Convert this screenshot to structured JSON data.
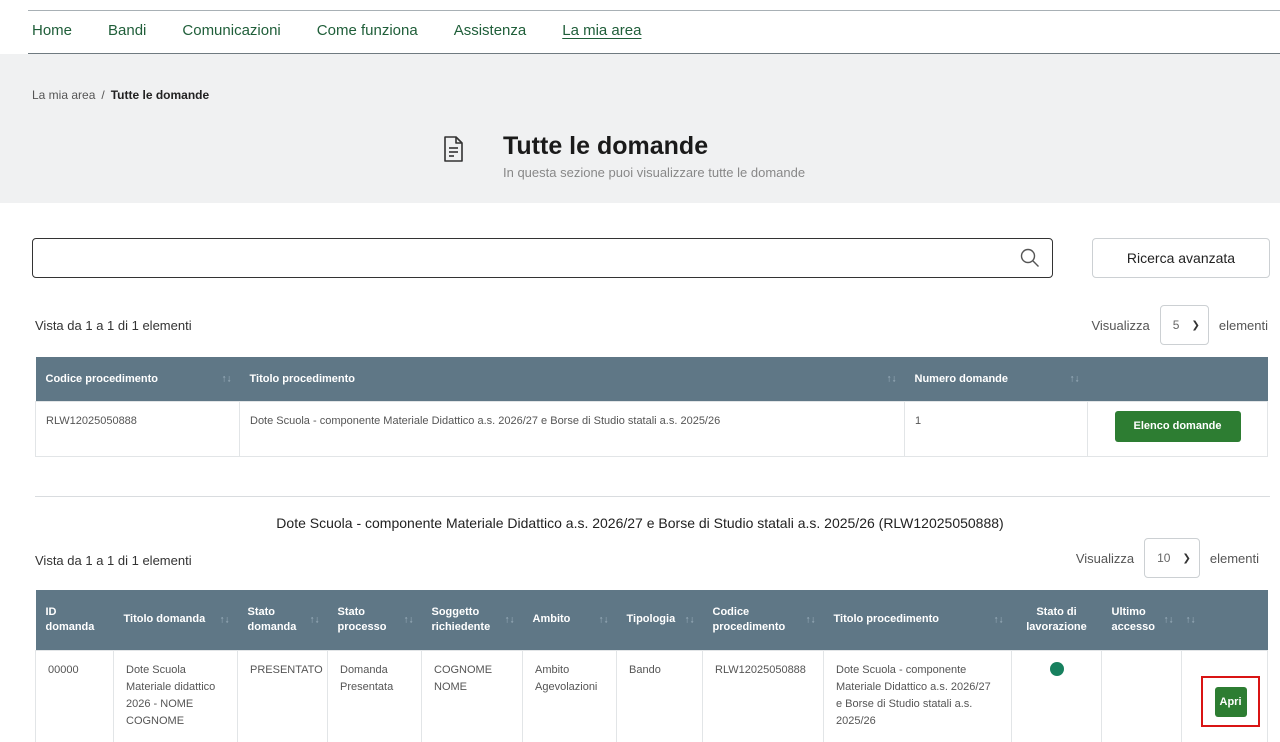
{
  "nav": {
    "items": [
      "Home",
      "Bandi",
      "Comunicazioni",
      "Come funziona",
      "Assistenza",
      "La mia area"
    ],
    "active": "La mia area"
  },
  "breadcrumb": {
    "parent": "La mia area",
    "separator": "/",
    "current": "Tutte le domande"
  },
  "header": {
    "title": "Tutte le domande",
    "subtitle": "In questa sezione puoi visualizzare tutte le domande",
    "icon": "document-icon"
  },
  "search": {
    "value": "",
    "placeholder": "",
    "icon": "search-icon",
    "advanced_label": "Ricerca avanzata"
  },
  "table1": {
    "count_text": "Vista da 1 a 1 di 1 elementi",
    "page_size": {
      "prefix": "Visualizza",
      "value": "5",
      "suffix": "elementi"
    },
    "headers": [
      "Codice procedimento",
      "Titolo procedimento",
      "Numero domande",
      ""
    ],
    "rows": [
      {
        "codice": "RLW12025050888",
        "titolo": "Dote Scuola - componente Materiale Didattico a.s. 2026/27 e Borse di Studio statali a.s. 2025/26",
        "numero": "1",
        "action": "Elenco domande"
      }
    ]
  },
  "section": {
    "title": "Dote Scuola - componente Materiale Didattico a.s. 2026/27 e Borse di Studio statali a.s. 2025/26 (RLW12025050888)"
  },
  "table2": {
    "count_text": "Vista da 1 a 1 di 1 elementi",
    "page_size": {
      "prefix": "Visualizza",
      "value": "10",
      "suffix": "elementi"
    },
    "headers": [
      "ID domanda",
      "Titolo domanda",
      "Stato domanda",
      "Stato processo",
      "Soggetto richiedente",
      "Ambito",
      "Tipologia",
      "Codice procedimento",
      "Titolo procedimento",
      "Stato di lavorazione",
      "Ultimo accesso",
      ""
    ],
    "rows": [
      {
        "id": "00000",
        "titolo_domanda": "Dote Scuola Materiale didattico 2026 - NOME COGNOME",
        "stato_domanda": "PRESENTATO",
        "stato_processo": "Domanda Presentata",
        "soggetto": "COGNOME NOME",
        "ambito": "Ambito Agevolazioni",
        "tipologia": "Bando",
        "codice": "RLW12025050888",
        "titolo_procedimento": "Dote Scuola - componente Materiale Didattico a.s. 2026/27 e Borse di Studio statali a.s. 2025/26",
        "stato_lavorazione_color": "#17805e",
        "ultimo_accesso": "",
        "action": "Apri"
      }
    ]
  },
  "colors": {
    "primary_green": "#2d7d32",
    "table_header": "#5f7786",
    "highlight": "#d91414",
    "nav_link": "#1f5e39"
  }
}
